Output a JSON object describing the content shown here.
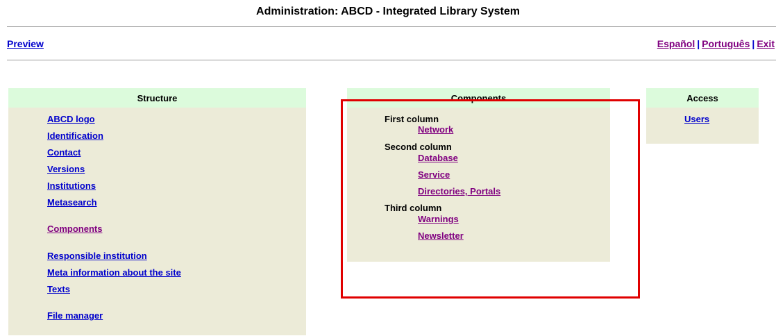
{
  "header": {
    "title": "Administration: ABCD - Integrated Library System"
  },
  "topnav": {
    "preview": "Preview",
    "languages": [
      {
        "label": "Español"
      },
      {
        "label": "Português"
      },
      {
        "label": "Exit"
      }
    ],
    "separator": "|"
  },
  "structure": {
    "heading": "Structure",
    "links": [
      {
        "label": "ABCD logo"
      },
      {
        "label": "Identification"
      },
      {
        "label": "Contact"
      },
      {
        "label": "Versions"
      },
      {
        "label": "Institutions"
      },
      {
        "label": "Metasearch"
      },
      {
        "label": "Components"
      },
      {
        "label": "Responsible institution"
      },
      {
        "label": "Meta information about the site"
      },
      {
        "label": "Texts"
      },
      {
        "label": "File manager"
      }
    ]
  },
  "components": {
    "heading": "Components",
    "groups": [
      {
        "label": "First column",
        "links": [
          {
            "label": "Network"
          }
        ]
      },
      {
        "label": "Second column",
        "links": [
          {
            "label": "Database"
          },
          {
            "label": "Service"
          },
          {
            "label": "Directories, Portals"
          }
        ]
      },
      {
        "label": "Third column",
        "links": [
          {
            "label": "Warnings"
          },
          {
            "label": "Newsletter"
          }
        ]
      }
    ]
  },
  "access": {
    "heading": "Access",
    "links": [
      {
        "label": "Users"
      }
    ]
  },
  "colors": {
    "link_blue": "#0000cc",
    "visited_purple": "#800080",
    "panel_bg": "#ecebd8",
    "panel_head_bg": "#dcfbdc",
    "highlight_red": "#e00000"
  }
}
